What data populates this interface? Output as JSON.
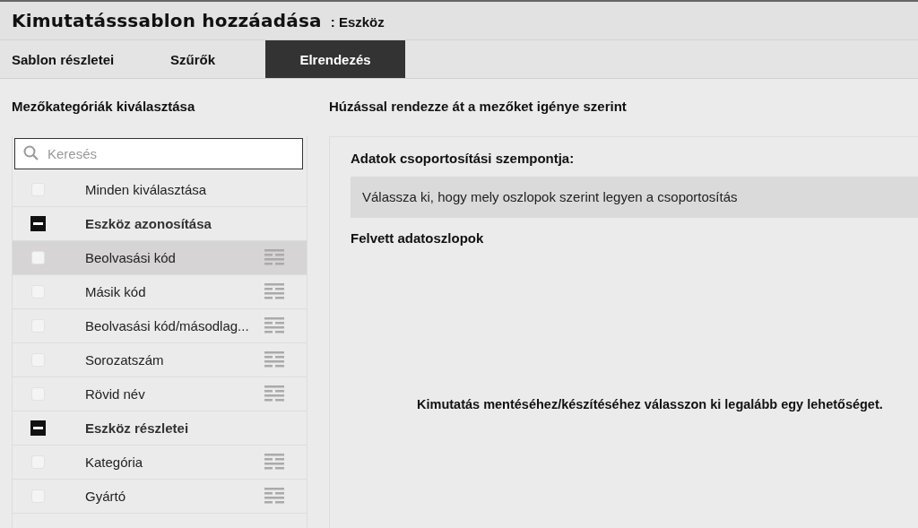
{
  "window": {
    "title": "Kimutatásssablon hozzáadása",
    "subtitle": ": Eszköz"
  },
  "tabs": [
    {
      "label": "Sablon részletei",
      "selected": false
    },
    {
      "label": "Szűrők",
      "selected": false
    },
    {
      "label": "Elrendezés",
      "selected": true
    }
  ],
  "left_panel": {
    "heading": "Mezőkategóriák kiválasztása",
    "search": {
      "placeholder": "Keresés"
    },
    "items": [
      {
        "kind": "select_all",
        "label": "Minden kiválasztása",
        "checked": false
      },
      {
        "kind": "group",
        "label": "Eszköz azonosítása",
        "expanded": true,
        "children": [
          {
            "label": "Beolvasási kód",
            "checked": false,
            "selected": true
          },
          {
            "label": "Másik kód",
            "checked": false,
            "selected": false
          },
          {
            "label": "Beolvasási kód/másodlag...",
            "checked": false,
            "selected": false
          },
          {
            "label": "Sorozatszám",
            "checked": false,
            "selected": false
          },
          {
            "label": "Rövid név",
            "checked": false,
            "selected": false
          }
        ]
      },
      {
        "kind": "group",
        "label": "Eszköz részletei",
        "expanded": true,
        "children": [
          {
            "label": "Kategória",
            "checked": false,
            "selected": false
          },
          {
            "label": "Gyártó",
            "checked": false,
            "selected": false
          }
        ]
      }
    ]
  },
  "right_panel": {
    "heading": "Húzással rendezze át a mezőket igénye szerint",
    "group_by_label": "Adatok csoportosítási szempontja:",
    "group_by_placeholder": "Válassza ki, hogy mely oszlopok szerint legyen a csoportosítás",
    "columns_label": "Felvett adatoszlopok",
    "message": "Kimutatás mentéséhez/készítéséhez válasszon ki legalább egy lehetőséget."
  }
}
